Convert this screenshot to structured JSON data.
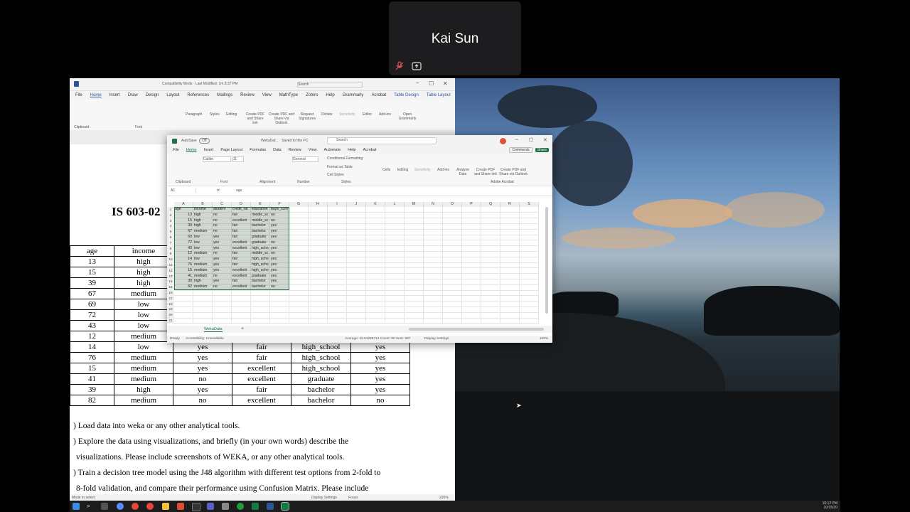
{
  "meeting": {
    "participant_name": "Kai Sun"
  },
  "word": {
    "doc_title": "IS 603-02",
    "table": {
      "headers": [
        "age",
        "income",
        "",
        "",
        "",
        ""
      ],
      "rows": [
        [
          "13",
          "high",
          "",
          "",
          "",
          ""
        ],
        [
          "15",
          "high",
          "",
          "",
          "",
          ""
        ],
        [
          "39",
          "high",
          "",
          "",
          "",
          ""
        ],
        [
          "67",
          "medium",
          "",
          "",
          "",
          ""
        ],
        [
          "69",
          "low",
          "",
          "",
          "",
          ""
        ],
        [
          "72",
          "low",
          "",
          "",
          "",
          ""
        ],
        [
          "43",
          "low",
          "",
          "",
          "",
          ""
        ],
        [
          "12",
          "medium",
          "",
          "",
          "",
          ""
        ],
        [
          "14",
          "low",
          "yes",
          "fair",
          "high_school",
          "yes"
        ],
        [
          "76",
          "medium",
          "yes",
          "fair",
          "high_school",
          "yes"
        ],
        [
          "15",
          "medium",
          "yes",
          "excellent",
          "high_school",
          "yes"
        ],
        [
          "41",
          "medium",
          "no",
          "excellent",
          "graduate",
          "yes"
        ],
        [
          "39",
          "high",
          "yes",
          "fair",
          "bachelor",
          "yes"
        ],
        [
          "82",
          "medium",
          "no",
          "excellent",
          "bachelor",
          "no"
        ]
      ]
    },
    "questions": [
      ")  Load data into weka or any other analytical tools.",
      ")  Explore  the  data  using  visualizations,  and  briefly  (in  your  own  words)  describe  the",
      "visualizations. Please include screenshots of WEKA, or any other analytical tools.",
      ")  Train a decision tree model using the J48 algorithm with different test options from 2-fold to",
      "8-fold validation, and compare their performance using Confusion Matrix. Please include"
    ],
    "tabs": [
      "File",
      "Home",
      "Insert",
      "Draw",
      "Design",
      "Layout",
      "References",
      "Mailings",
      "Review",
      "View",
      "MathType",
      "Zotero",
      "Help",
      "Grammarly",
      "Acrobat",
      "Table Design",
      "Table Layout"
    ],
    "title_text": "Compatibility Mode · Last Modified: 1m 8:37 PM",
    "search_placeholder": "Search",
    "ribbon_groups": [
      "Clipboard",
      "Font",
      "Paragraph",
      "Styles",
      "Editing",
      "Create PDF and Share link",
      "Create PDF and Share via Outlook",
      "Request Signatures",
      "Dictate",
      "Sensitivity",
      "Editor",
      "Add-ins",
      "Open Grammarly"
    ],
    "status": "Mode to select",
    "status_right": [
      "Display Settings",
      "Focus",
      "220%"
    ]
  },
  "excel": {
    "autosave": "AutoSave",
    "autosave_state": "Off",
    "title": "WekaDat... · Saved to this PC",
    "search_placeholder": "Search",
    "tabs": [
      "File",
      "Home",
      "Insert",
      "Page Layout",
      "Formulas",
      "Data",
      "Review",
      "View",
      "Automate",
      "Help",
      "Acrobat"
    ],
    "comments_label": "Comments",
    "share_label": "Share",
    "ribbon": {
      "font_name": "Calibri",
      "font_size": "11",
      "number_format": "General",
      "conditional": "Conditional Formatting",
      "format_table": "Format as Table",
      "cell_styles": "Cell Styles",
      "groups": [
        "Clipboard",
        "Font",
        "Alignment",
        "Number",
        "Styles",
        "Cells",
        "Editing",
        "Sensitivity",
        "Add-ins",
        "Analyze Data",
        "Create PDF and Share link",
        "Create PDF and Share via Outlook",
        "Adobe Acrobat"
      ]
    },
    "name_box": "A1",
    "formula": "age",
    "columns": [
      "A",
      "B",
      "C",
      "D",
      "E",
      "F",
      "G",
      "H",
      "I",
      "J",
      "K",
      "L",
      "M",
      "N",
      "O",
      "P",
      "Q",
      "R",
      "S"
    ],
    "header_row": [
      "age",
      "income",
      "student",
      "credit_rat",
      "education",
      "buys_computer"
    ],
    "rows": [
      [
        "13",
        "high",
        "no",
        "fair",
        "middle_sc",
        "no"
      ],
      [
        "15",
        "high",
        "no",
        "excellent",
        "middle_sc",
        "no"
      ],
      [
        "39",
        "high",
        "no",
        "fair",
        "bachelor",
        "yes"
      ],
      [
        "67",
        "medium",
        "no",
        "fair",
        "bachelor",
        "yes"
      ],
      [
        "69",
        "low",
        "yes",
        "fair",
        "graduate",
        "yes"
      ],
      [
        "72",
        "low",
        "yes",
        "excellent",
        "graduate",
        "no"
      ],
      [
        "43",
        "low",
        "yes",
        "excellent",
        "high_scho",
        "yes"
      ],
      [
        "12",
        "medium",
        "no",
        "fair",
        "middle_sc",
        "no"
      ],
      [
        "14",
        "low",
        "yes",
        "fair",
        "high_scho",
        "yes"
      ],
      [
        "76",
        "medium",
        "yes",
        "fair",
        "high_scho",
        "yes"
      ],
      [
        "15",
        "medium",
        "yes",
        "excellent",
        "high_scho",
        "yes"
      ],
      [
        "41",
        "medium",
        "no",
        "excellent",
        "graduate",
        "yes"
      ],
      [
        "39",
        "high",
        "yes",
        "fair",
        "bachelor",
        "yes"
      ],
      [
        "82",
        "medium",
        "no",
        "excellent",
        "bachelor",
        "no"
      ]
    ],
    "row_numbers": [
      "1",
      "2",
      "3",
      "4",
      "5",
      "6",
      "7",
      "8",
      "9",
      "10",
      "11",
      "12",
      "13",
      "14",
      "15",
      "16",
      "17",
      "18",
      "19",
      "20",
      "21"
    ],
    "sheet_tab": "WekaData",
    "status_ready": "Ready",
    "status_accessibility": "Accessibility: Unavailable",
    "status_stats": "Average: 42.64285714   Count: 90   Sum: 597",
    "status_display": "Display Settings",
    "zoom": "100%"
  },
  "taskbar": {
    "time": "10:12 PM",
    "date": "10/15/20"
  }
}
